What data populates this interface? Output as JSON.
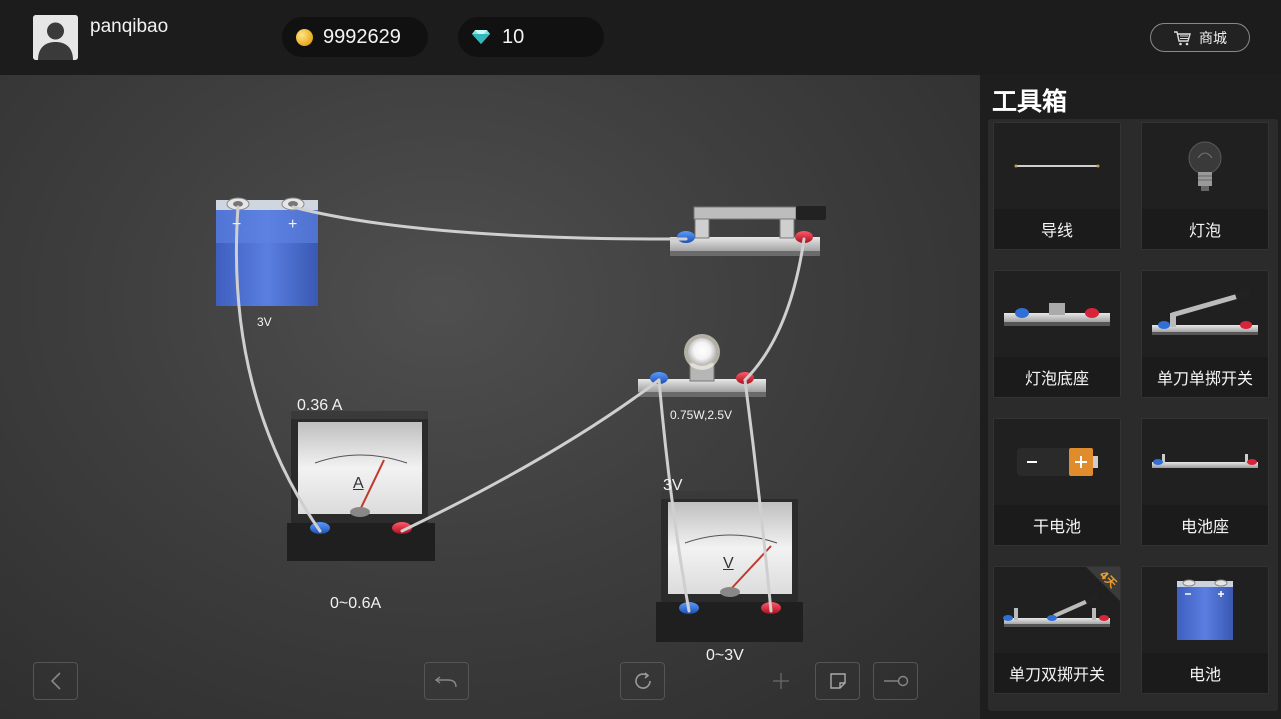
{
  "header": {
    "username": "panqibao",
    "coins": "9992629",
    "gems": "10",
    "shop_label": "商城"
  },
  "workspace": {
    "battery_voltage": "3V",
    "bulb_spec": "0.75W,2.5V",
    "ammeter_reading": "0.36 A",
    "ammeter_range": "0~0.6A",
    "ammeter_letter": "A",
    "voltmeter_reading": "3V",
    "voltmeter_range": "0~3V",
    "voltmeter_letter": "V",
    "battery_minus": "−",
    "battery_plus": "+"
  },
  "toolbox": {
    "title": "工具箱",
    "items": [
      {
        "label": "导线",
        "icon": "wire-icon"
      },
      {
        "label": "灯泡",
        "icon": "bulb-icon"
      },
      {
        "label": "灯泡底座",
        "icon": "bulb-base-icon"
      },
      {
        "label": "单刀单掷开关",
        "icon": "spst-switch-icon"
      },
      {
        "label": "干电池",
        "icon": "dry-cell-icon"
      },
      {
        "label": "电池座",
        "icon": "battery-holder-icon"
      },
      {
        "label": "单刀双掷开关",
        "icon": "spdt-switch-icon",
        "badge": "4天"
      },
      {
        "label": "电池",
        "icon": "battery-icon"
      }
    ]
  },
  "colors": {
    "terminal_negative": "#2f6fd6",
    "terminal_positive": "#d8243a",
    "battery_blue": "#4a6fd0",
    "needle": "#c0392b"
  }
}
